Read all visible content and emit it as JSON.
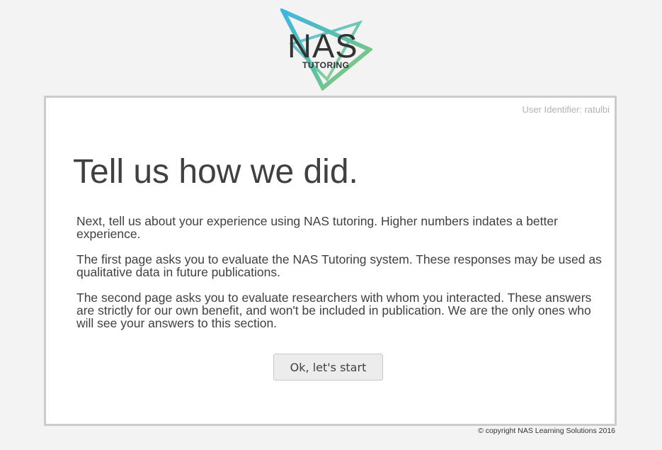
{
  "logo": {
    "name": "NAS",
    "subtitle": "TUTORING",
    "colors": [
      "#4fb8d8",
      "#5fc1a0",
      "#9ccf6a"
    ]
  },
  "user_identifier": "User Identifier: ratulbi",
  "page_title": "Tell us how we did.",
  "paragraphs": [
    "Next, tell us about your experience using NAS tutoring. Higher numbers indates a better experience.",
    "The first page asks you to evaluate the NAS Tutoring system. These responses may be used as qualitative data in future publications.",
    "The second page asks you to evaluate researchers with whom you interacted. These answers are strictly for our own benefit, and won't be included in publication. We are the only ones who will see your answers to this section."
  ],
  "start_button_label": "Ok, let's start",
  "copyright": "© copyright NAS Learning Solutions 2016"
}
